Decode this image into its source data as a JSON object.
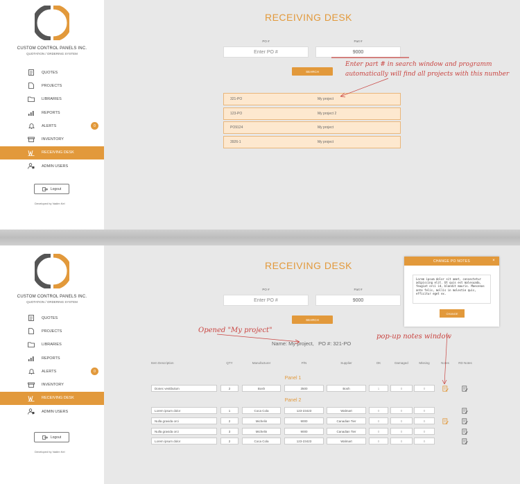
{
  "company": {
    "name": "CUSTOM CONTROL PANELS INC.",
    "subtitle": "QUOTATION / ORDERING SYSTEM"
  },
  "nav": [
    {
      "label": "QUOTES",
      "icon": "document-icon"
    },
    {
      "label": "PROJECTS",
      "icon": "file-icon"
    },
    {
      "label": "LIBRARIES",
      "icon": "folder-icon"
    },
    {
      "label": "REPORTS",
      "icon": "bar-chart-icon"
    },
    {
      "label": "ALERTS",
      "icon": "bell-icon",
      "badge": "0"
    },
    {
      "label": "INVENTORY",
      "icon": "warehouse-icon"
    },
    {
      "label": "RECEIVING DESK",
      "icon": "dolly-icon",
      "active": true
    },
    {
      "label": "ADMIN USERS",
      "icon": "users-icon"
    }
  ],
  "logout_label": "Logout",
  "developed_by": "Developed by Vadim Kel",
  "page_title": "RECEIVING DESK",
  "search": {
    "po_label": "PO #",
    "part_label": "Part #",
    "po_placeholder": "Enter PO #",
    "part_value": "9000",
    "button_label": "SEARCH"
  },
  "results": [
    {
      "po": "321-PO",
      "name": "My project"
    },
    {
      "po": "123-PO",
      "name": "My project 2"
    },
    {
      "po": "PO9124",
      "name": "My project"
    },
    {
      "po": "3926-1",
      "name": "My project"
    }
  ],
  "annotations": {
    "search_hint_line1": "Enter part # in search window and programm",
    "search_hint_line2": "automatically will find all projects with this number",
    "opened": "Opened \"My project\"",
    "popup": "pop-up notes window"
  },
  "project_info": {
    "name_label": "Name: My project,",
    "po_label": "PO #: 321-PO"
  },
  "table": {
    "headers": [
      "Item Description",
      "QTY",
      "Manufacturer",
      "P/N",
      "Supplier",
      "OK",
      "Damaged",
      "Missing",
      "Notes",
      "RD Notes"
    ],
    "panels": [
      {
        "title": "Panel 1",
        "rows": [
          {
            "desc": "Donec vestibulum",
            "qty": "2",
            "mfr": "Bosh",
            "pn": "3500",
            "supplier": "Bosh",
            "ok": "1",
            "damaged": "0",
            "missing": "0",
            "note": true
          }
        ]
      },
      {
        "title": "Panel 2",
        "rows": [
          {
            "desc": "Lorem ipsum dolor",
            "qty": "1",
            "mfr": "Coca Cola",
            "pn": "123-23423",
            "supplier": "Walmart",
            "ok": "0",
            "damaged": "0",
            "missing": "0",
            "note": false
          },
          {
            "desc": "Nulla gravida orci",
            "qty": "2",
            "mfr": "Michelin",
            "pn": "9000",
            "supplier": "Canadian Tier",
            "ok": "0",
            "damaged": "0",
            "missing": "0",
            "note": true
          },
          {
            "desc": "Nulla gravida orci",
            "qty": "3",
            "mfr": "Michelin",
            "pn": "9000",
            "supplier": "Canadian Tier",
            "ok": "0",
            "damaged": "0",
            "missing": "0",
            "note": false
          },
          {
            "desc": "Lorem ipsum dolor",
            "qty": "2",
            "mfr": "Coca Cola",
            "pn": "123-23423",
            "supplier": "Walmart",
            "ok": "0",
            "damaged": "0",
            "missing": "0",
            "note": false
          }
        ]
      }
    ]
  },
  "modal": {
    "title": "CHANGE PO NOTES",
    "close": "×",
    "text": "Lorem ipsum dolor sit amet, consectetur adipiscing elit. Ut quis est malesuada, feugiat orci id, blandit mauris. Maecenas ante felis, mollis in molestie quis, efficitur eget ex.",
    "button_label": "CHANGE"
  },
  "colors": {
    "accent": "#e2993b",
    "annotation": "#c94440",
    "sidebar": "#ffffff",
    "canvas": "#e8e8e8"
  }
}
